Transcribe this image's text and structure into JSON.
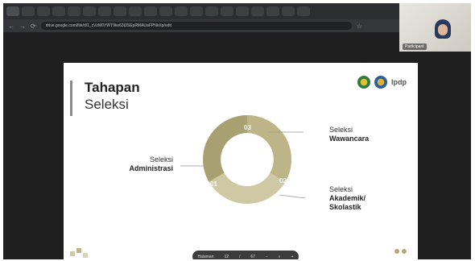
{
  "browser": {
    "url": "drive.google.com/file/d/1_cVzM0YWT9ke63t3SEpRMAUaFPNkXp/edit",
    "tabs": [
      "■",
      "■",
      "■",
      "■",
      "■",
      "■",
      "■",
      "■",
      "■",
      "■",
      "■",
      "■",
      "■",
      "■",
      "■",
      "■",
      "■",
      "■",
      "■",
      "■"
    ]
  },
  "camera": {
    "participant_name": "Participant"
  },
  "slide": {
    "title_line1": "Tahapan",
    "title_line2": "Seleksi",
    "logo_text": "lpdp",
    "segments": [
      {
        "number": "01",
        "label_top": "Seleksi",
        "label_bold": "Administrasi"
      },
      {
        "number": "02",
        "label_top": "Seleksi",
        "label_bold": "Akademik/ Skolastik"
      },
      {
        "number": "03",
        "label_top": "Seleksi",
        "label_bold": "Wawancara"
      }
    ],
    "colors": {
      "gold_dark": "#a8a071",
      "gold_light": "#cfc8a4",
      "gold_mid": "#bdb488"
    }
  },
  "pager": {
    "label": "Halaman",
    "current": "12",
    "separator": "/",
    "total": "67",
    "zoom_out": "−",
    "zoom_icon": "⌕",
    "zoom_in": "+"
  }
}
